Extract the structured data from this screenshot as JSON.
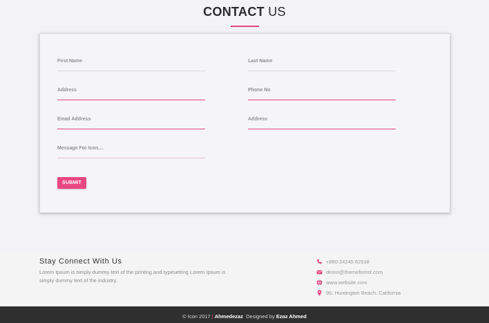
{
  "header": {
    "title_bold": "CONTACT",
    "title_light": "US"
  },
  "form": {
    "fields": [
      {
        "label": "First Name"
      },
      {
        "label": "Last Name"
      },
      {
        "label": "Address"
      },
      {
        "label": "Phone No"
      },
      {
        "label": "Email Address"
      },
      {
        "label": "Address"
      },
      {
        "label": "Message For Icon...."
      }
    ],
    "submit_label": "SUBMIT"
  },
  "footer": {
    "heading": "Stay Connect With Us",
    "text": "Lorem Ipsum is simply dummy text of the printing and typesetting Lorem Ipsum is simply dummy text of the industry.",
    "contacts": [
      {
        "icon": "phone-icon",
        "text": "+880 24245 82538"
      },
      {
        "icon": "envelope-icon",
        "text": "demo@themeforest.com"
      },
      {
        "icon": "globe-icon",
        "text": "www.website.com"
      },
      {
        "icon": "map-marker-icon",
        "text": "96, Huntington Beach, California"
      }
    ]
  },
  "bottom_bar": {
    "copyright": "© Icon 2017",
    "separator": "|",
    "author": "Ahmedezaz",
    "designed_by": "Designed by",
    "designer": "Ezaz Ahmed"
  },
  "colors": {
    "accent": "#e4437f",
    "bottom_bar": "#2f2f2f"
  }
}
